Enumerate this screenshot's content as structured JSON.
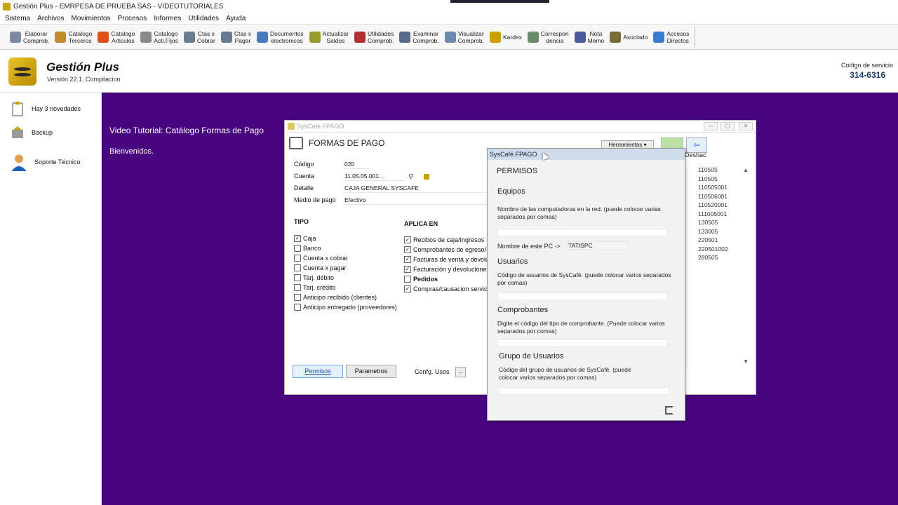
{
  "window": {
    "title": "Gestión Plus - EMRPESA DE PRUEBA SAS - VIDEOTUTORIALES"
  },
  "menu": [
    "Sistema",
    "Archivos",
    "Movimientos",
    "Procesos",
    "Informes",
    "Utilidades",
    "Ayuda"
  ],
  "toolbar": [
    {
      "label": "Elaborar\nComprob.",
      "icon": "edit-document-icon",
      "color": "#7a8aa0"
    },
    {
      "label": "Catalogo\nTerceros",
      "icon": "user-icon",
      "color": "#c48a2a"
    },
    {
      "label": "Catalogo\nArticulos",
      "icon": "box-icon",
      "color": "#e0501c"
    },
    {
      "label": "Catalogo\nActi.Fijos",
      "icon": "tools-icon",
      "color": "#8a8a8a"
    },
    {
      "label": "Ctas x\nCobrar",
      "icon": "receivable-icon",
      "color": "#6a7a90"
    },
    {
      "label": "Ctas x\nPagar",
      "icon": "payable-icon",
      "color": "#6a7a90"
    },
    {
      "label": "Documentos\nelectronicos",
      "icon": "electronic-docs-icon",
      "color": "#4a7abf"
    },
    {
      "label": "Actualizar\nSaldos",
      "icon": "refresh-gear-icon",
      "color": "#9a9a2a"
    },
    {
      "label": "Utilidades\nComprob.",
      "icon": "utilities-icon",
      "color": "#b03030"
    },
    {
      "label": "Examinar\nComprob.",
      "icon": "examine-icon",
      "color": "#5a6a8a"
    },
    {
      "label": "Visualizar\nComprob.",
      "icon": "view-icon",
      "color": "#6a8ab0"
    },
    {
      "label": "Kardex",
      "icon": "kardex-icon",
      "color": "#c9a100"
    },
    {
      "label": "Correspon\ndencia",
      "icon": "mail-icon",
      "color": "#6a8a6a"
    },
    {
      "label": "Nota\nMemo",
      "icon": "memo-icon",
      "color": "#4a5a9a"
    },
    {
      "label": "Asociado",
      "icon": "associate-icon",
      "color": "#7a6a3a"
    },
    {
      "label": "Accesos\nDirectos",
      "icon": "folder-icon",
      "color": "#3a7ad0"
    }
  ],
  "header": {
    "brand": "Gestión Plus",
    "version": "Versión 22.1.  Compilacion",
    "service_label": "Codigo de servicio",
    "service_code": "314-6316"
  },
  "sidebar": [
    {
      "label": "Hay 3 novedades",
      "icon": "clipboard-icon"
    },
    {
      "label": "Backup",
      "icon": "backup-icon"
    },
    {
      "label": "Soporte Técnico",
      "icon": "support-agent-icon"
    }
  ],
  "workspace": {
    "line1": "Video Tutorial: Catálogo Formas de Pago",
    "line2": "Bienvenidos."
  },
  "form_window": {
    "title": "SysCafé.FPAGO",
    "heading": "FORMAS DE PAGO",
    "tools_label": "Herramientas",
    "undo_label": "Deshac",
    "fields": {
      "codigo_label": "Código",
      "codigo": "020",
      "cuenta_label": "Cuenta",
      "cuenta": "11.05.05.001.  .",
      "detalle_label": "Detalle",
      "detalle": "CAJA GENERAL SYSCAFE",
      "medio_label": "Medio de pago",
      "medio": "Efectivo"
    },
    "tipo_title": "TIPO",
    "tipo": [
      {
        "label": "Caja",
        "checked": true
      },
      {
        "label": "Banco",
        "checked": false
      },
      {
        "label": "Cuenta x cobrar",
        "checked": false
      },
      {
        "label": "Cuenta x pagar",
        "checked": false
      },
      {
        "label": "Tarj. débito",
        "checked": false
      },
      {
        "label": "Tarj. crédito",
        "checked": false
      },
      {
        "label": "Anticipo recibido (clientes)",
        "checked": false
      },
      {
        "label": "Anticipo entregado (proveedores)",
        "checked": false
      }
    ],
    "aplica_title": "APLICA EN",
    "aplica": [
      {
        "label": "Recibos de caja/Ingresos",
        "checked": true
      },
      {
        "label": "Comprobantes de egreso/P",
        "checked": true
      },
      {
        "label": "Facturas de venta y devoluc",
        "checked": true
      },
      {
        "label": "Facturación y devoluciones",
        "checked": true
      },
      {
        "label": "Pedidos",
        "checked": false
      },
      {
        "label": "Compras/causacion servicio",
        "checked": true
      }
    ],
    "buttons": {
      "permisos": "Permisos",
      "parametros": "Parametros",
      "conf_usos": "Confg. Usos",
      "dots": "..."
    },
    "accounts": [
      "110505",
      "110505",
      "110505001",
      "110506001",
      "110520001",
      "111005001",
      "130505",
      "133005",
      "220501",
      "220501002",
      "280505"
    ]
  },
  "permisos": {
    "title": "SysCafé.FPAGO",
    "heading": "PERMISOS",
    "equipos_title": "Equipos",
    "equipos_desc": "Nombre de las computadoras en la red. (puede colocar varias separados por comas)",
    "pc_label": "Nombre de este PC ->",
    "pc_value": "TATISPC",
    "usuarios_title": "Usuarios",
    "usuarios_desc": "Código de usuarios de SysCafé. (puede colocar varios separados por comas)",
    "comprobantes_title": "Comprobantes",
    "comprobantes_desc": "Digite el código del tipo de comprobante. (Puede colocar varios separados por comas)",
    "grupo_title": "Grupo de Usuarios",
    "grupo_desc": "Código del grupo de usuarios de SysCafé. (puede colocar varios separados por comas)"
  }
}
